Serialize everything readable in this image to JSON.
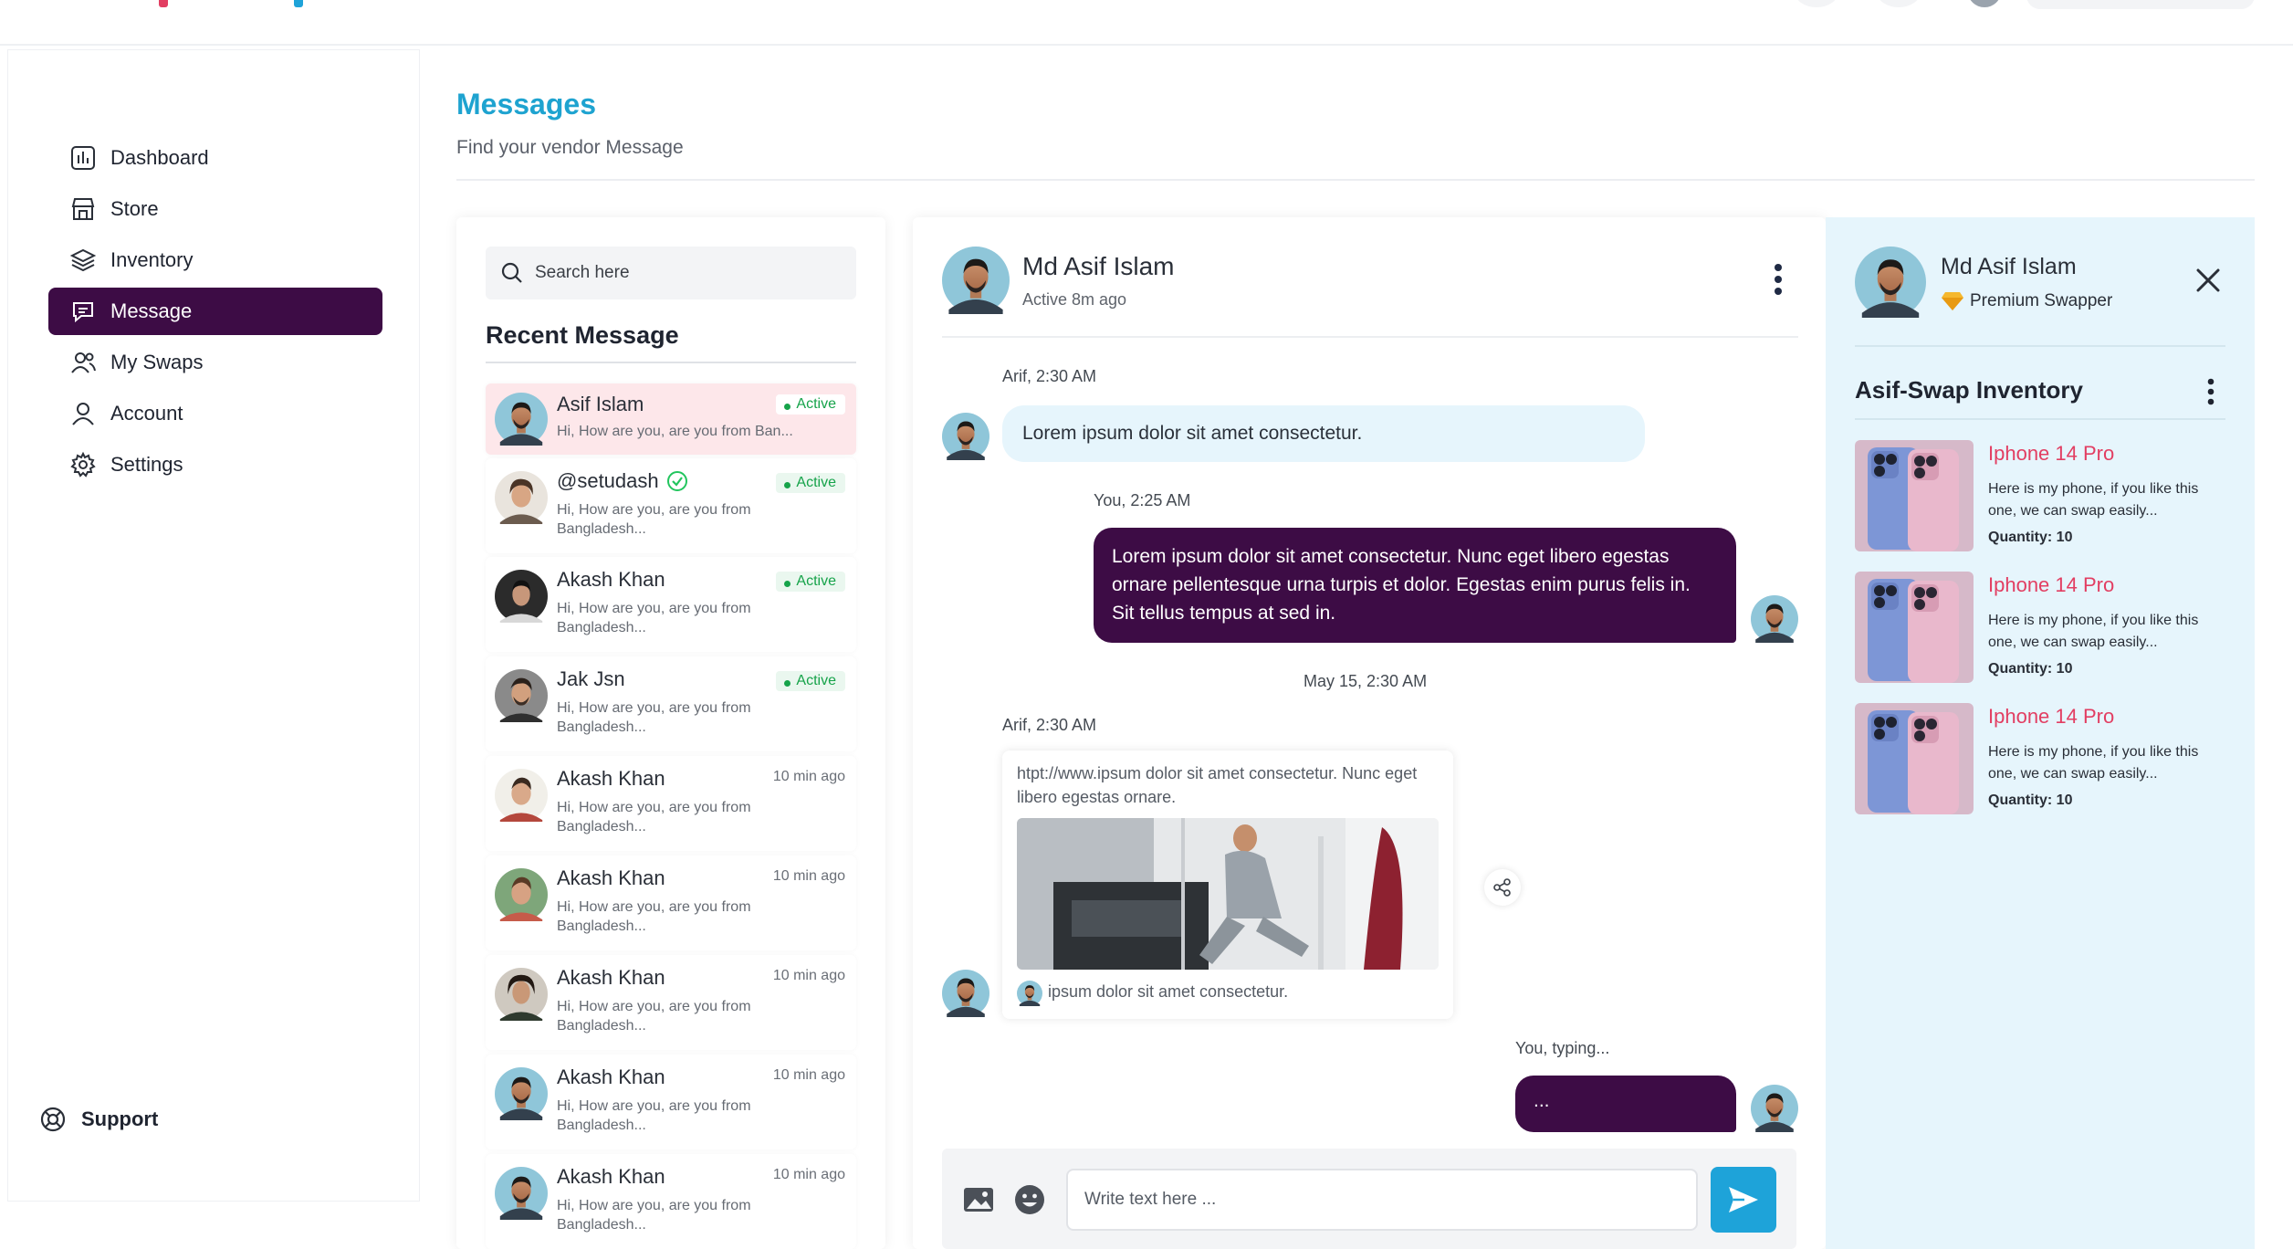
{
  "nav": {
    "items": [
      {
        "label": "Dashboard",
        "icon": "dashboard-icon"
      },
      {
        "label": "Store",
        "icon": "store-icon"
      },
      {
        "label": "Inventory",
        "icon": "layers-icon"
      },
      {
        "label": "Message",
        "icon": "message-icon"
      },
      {
        "label": "My Swaps",
        "icon": "users-icon"
      },
      {
        "label": "Account",
        "icon": "user-icon"
      },
      {
        "label": "Settings",
        "icon": "gear-icon"
      }
    ],
    "active_index": 3,
    "support_label": "Support"
  },
  "header": {
    "title": "Messages",
    "subtitle": "Find your vendor Message"
  },
  "recent": {
    "search_placeholder": "Search here",
    "title": "Recent Message",
    "conversations": [
      {
        "name": "Asif Islam",
        "preview": "Hi, How are you, are you from Ban...",
        "status": "Active",
        "time": ""
      },
      {
        "name": "@setudash",
        "preview": "Hi, How are you, are you from Bangladesh...",
        "status": "Active",
        "time": ""
      },
      {
        "name": "Akash Khan",
        "preview": "Hi, How are you, are you from Bangladesh...",
        "status": "Active",
        "time": ""
      },
      {
        "name": "Jak Jsn",
        "preview": "Hi, How are you, are you from Bangladesh...",
        "status": "Active",
        "time": ""
      },
      {
        "name": "Akash Khan",
        "preview": "Hi, How are you, are you from Bangladesh...",
        "status": "",
        "time": "10 min ago"
      },
      {
        "name": "Akash Khan",
        "preview": "Hi, How are you, are you from Bangladesh...",
        "status": "",
        "time": "10 min ago"
      },
      {
        "name": "Akash Khan",
        "preview": "Hi, How are you, are you from Bangladesh...",
        "status": "",
        "time": "10 min ago"
      },
      {
        "name": "Akash Khan",
        "preview": "Hi, How are you, are you from Bangladesh...",
        "status": "",
        "time": "10 min ago"
      },
      {
        "name": "Akash Khan",
        "preview": "Hi, How are you, are you from Bangladesh...",
        "status": "",
        "time": "10 min ago"
      }
    ]
  },
  "chat": {
    "name": "Md Asif Islam",
    "status": "Active 8m ago",
    "messages": {
      "m1_meta": "Arif, 2:30 AM",
      "m1_text": "Lorem ipsum dolor sit amet consectetur.",
      "m2_meta": "You, 2:25 AM",
      "m2_text": "Lorem ipsum dolor sit amet consectetur. Nunc eget libero egestas ornare pellentesque urna turpis et dolor. Egestas enim purus felis in. Sit tellus tempus at sed in.",
      "date_divider": "May 15, 2:30 AM",
      "m3_meta": "Arif, 2:30 AM",
      "m3_link": "htpt://www.ipsum dolor sit amet consectetur. Nunc eget libero egestas ornare.",
      "m3_caption": "ipsum dolor sit amet consectetur.",
      "typing_meta": "You, typing...",
      "typing_text": "..."
    },
    "composer_placeholder": "Write text here ...",
    "send_color": "#1ea3d9"
  },
  "profile": {
    "name": "Md Asif Islam",
    "badge": "Premium Swapper",
    "inventory_title": "Asif-Swap Inventory",
    "items": [
      {
        "name": "Iphone 14 Pro",
        "desc": "Here is my phone, if you like this one, we can swap easily...",
        "qty": "Quantity: 10"
      },
      {
        "name": "Iphone 14 Pro",
        "desc": "Here is my phone, if you like this one, we can swap easily...",
        "qty": "Quantity: 10"
      },
      {
        "name": "Iphone 14 Pro",
        "desc": "Here is my phone, if you like this one, we can swap easily...",
        "qty": "Quantity: 10"
      }
    ]
  },
  "colors": {
    "accent": "#1ea3d0",
    "active_nav": "#3d0c45",
    "outgoing_bubble": "#3d0c45",
    "incoming_bubble": "#e6f5fc",
    "product_name": "#e23e62",
    "active_status": "#16a34a"
  }
}
